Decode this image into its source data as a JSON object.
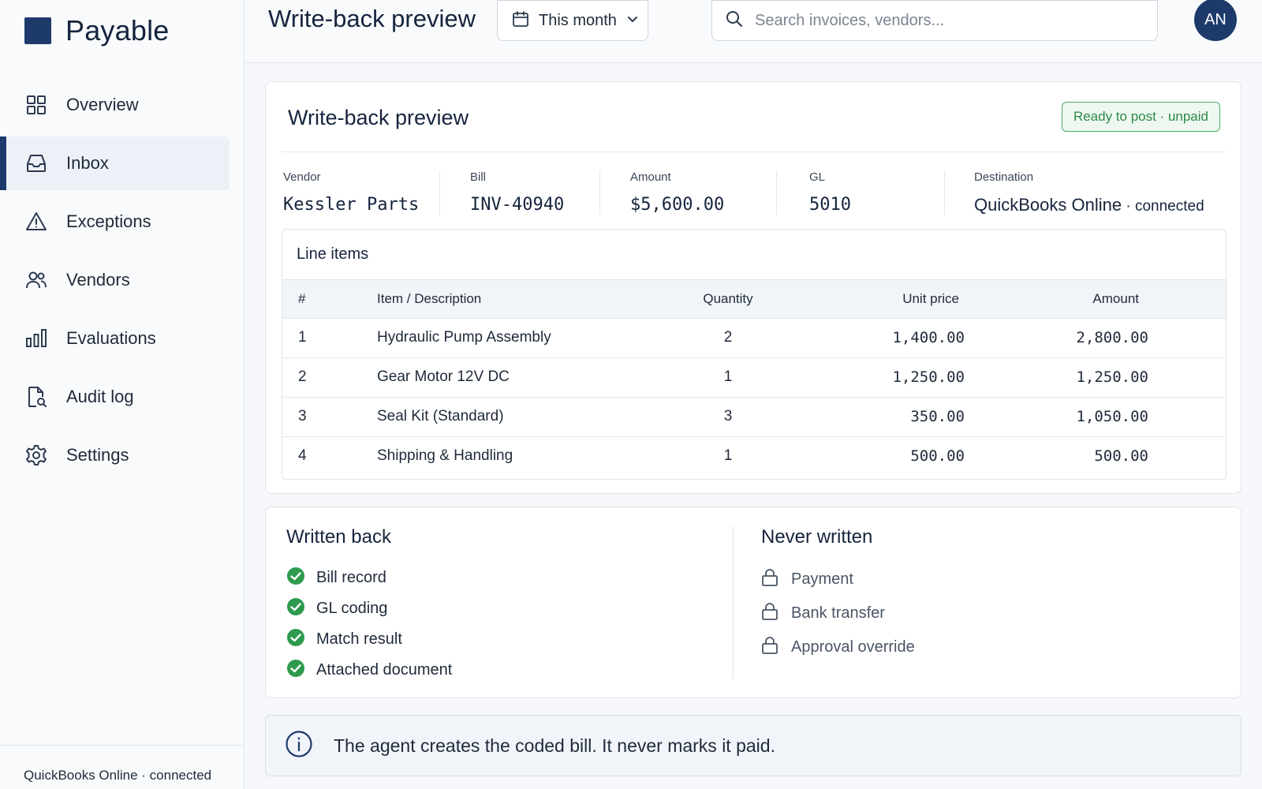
{
  "app": {
    "name": "Payable"
  },
  "sidebar": {
    "items": [
      {
        "label": "Overview",
        "icon": "grid-icon",
        "active": false
      },
      {
        "label": "Inbox",
        "icon": "inbox-icon",
        "active": true
      },
      {
        "label": "Exceptions",
        "icon": "warning-icon",
        "active": false
      },
      {
        "label": "Vendors",
        "icon": "users-icon",
        "active": false
      },
      {
        "label": "Evaluations",
        "icon": "bar-chart-icon",
        "active": false
      },
      {
        "label": "Audit log",
        "icon": "document-search-icon",
        "active": false
      },
      {
        "label": "Settings",
        "icon": "gear-icon",
        "active": false
      }
    ],
    "footer": "QuickBooks Online · connected"
  },
  "header": {
    "title": "Write-back preview",
    "date_filter": "This month",
    "search_placeholder": "Search invoices, vendors...",
    "avatar_initials": "AN"
  },
  "preview": {
    "title": "Write-back preview",
    "status_badge": "Ready to post · unpaid",
    "meta": {
      "vendor_label": "Vendor",
      "vendor": "Kessler Parts",
      "bill_label": "Bill",
      "bill": "INV-40940",
      "amount_label": "Amount",
      "amount": "$5,600.00",
      "gl_label": "GL",
      "gl": "5010",
      "destination_label": "Destination",
      "destination": "QuickBooks Online",
      "destination_status": " · connected"
    },
    "line_items": {
      "title": "Line items",
      "columns": [
        "#",
        "Item / Description",
        "Quantity",
        "Unit price",
        "Amount"
      ],
      "rows": [
        {
          "num": "1",
          "desc": "Hydraulic Pump Assembly",
          "qty": "2",
          "unit": "1,400.00",
          "amount": "2,800.00"
        },
        {
          "num": "2",
          "desc": "Gear Motor 12V DC",
          "qty": "1",
          "unit": "1,250.00",
          "amount": "1,250.00"
        },
        {
          "num": "3",
          "desc": "Seal Kit (Standard)",
          "qty": "3",
          "unit": "350.00",
          "amount": "1,050.00"
        },
        {
          "num": "4",
          "desc": "Shipping & Handling",
          "qty": "1",
          "unit": "500.00",
          "amount": "500.00"
        }
      ]
    }
  },
  "written_back": {
    "title": "Written back",
    "items": [
      "Bill record",
      "GL coding",
      "Match result",
      "Attached document"
    ]
  },
  "never_written": {
    "title": "Never written",
    "items": [
      "Payment",
      "Bank transfer",
      "Approval override"
    ]
  },
  "info": {
    "text": "The agent creates the coded bill. It never marks it paid."
  },
  "colors": {
    "brand": "#1d3a6b",
    "success": "#2e9a4e",
    "badge_border": "#4caf6a"
  }
}
